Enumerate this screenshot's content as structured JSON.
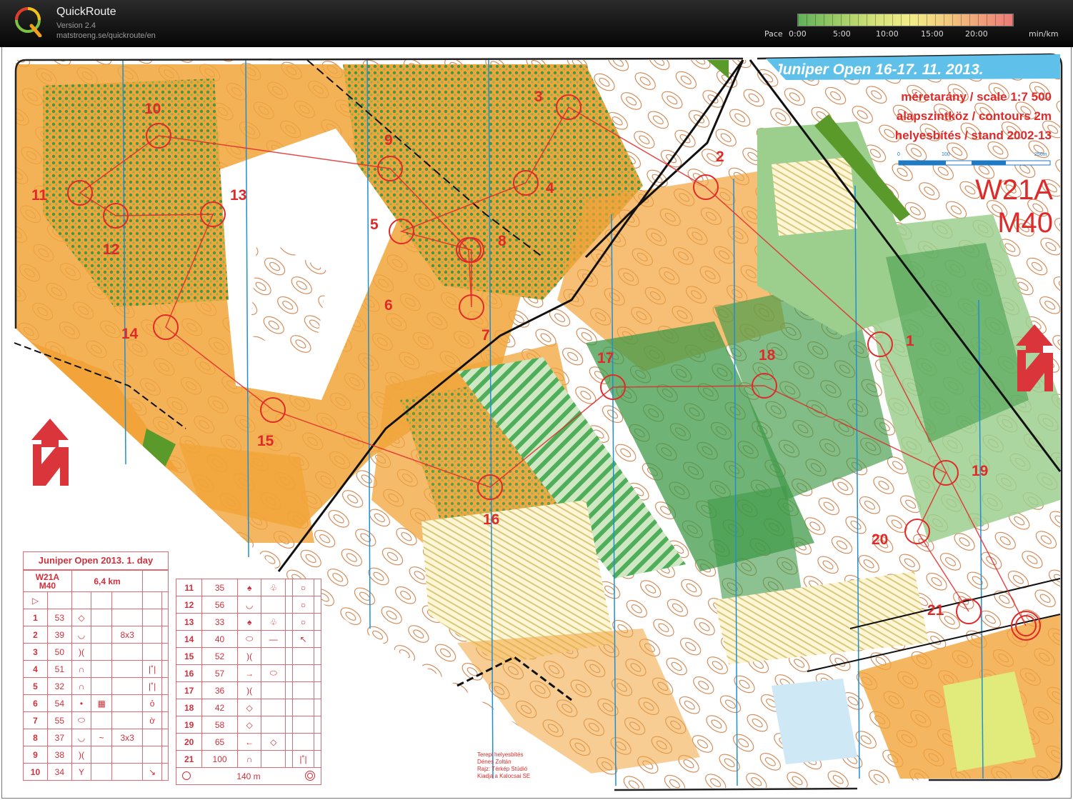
{
  "app": {
    "name": "QuickRoute",
    "version": "Version 2.4",
    "url": "matstroeng.se/quickroute/en",
    "logo_letter": "Q"
  },
  "pace_legend": {
    "title": "Pace",
    "labels": [
      "0:00",
      "5:00",
      "10:00",
      "15:00",
      "20:00"
    ],
    "unit": "min/km",
    "colors": [
      "#5fb05a",
      "#9ccc65",
      "#d6e27a",
      "#f2ee88",
      "#f3d27f",
      "#f0a87a",
      "#ec7a78"
    ]
  },
  "map": {
    "title": "Juniper Open 16-17. 11. 2013.",
    "scale": "méretarány / scale  1:7 500",
    "contours": "alapszintköz / contours  2m",
    "stand": "helyesbítés / stand  2002-13",
    "scale_bar_labels": [
      "0",
      "100",
      "250m"
    ],
    "course_lines": [
      "W21A",
      "M40"
    ],
    "colors": {
      "course": "#e02a2a",
      "open": "#f2a43a",
      "forest": "#3f9a48",
      "light_green": "#9ccf8e",
      "magnetic": "#1f8fd4",
      "title_band": "#5fc0ea"
    },
    "controls": [
      {
        "num": "1"
      },
      {
        "num": "2"
      },
      {
        "num": "3"
      },
      {
        "num": "4"
      },
      {
        "num": "5"
      },
      {
        "num": "6"
      },
      {
        "num": "7"
      },
      {
        "num": "8"
      },
      {
        "num": "9"
      },
      {
        "num": "10"
      },
      {
        "num": "11"
      },
      {
        "num": "12"
      },
      {
        "num": "13"
      },
      {
        "num": "14"
      },
      {
        "num": "15"
      },
      {
        "num": "16"
      },
      {
        "num": "17"
      },
      {
        "num": "18"
      },
      {
        "num": "19"
      },
      {
        "num": "20"
      },
      {
        "num": "21"
      }
    ],
    "credits": [
      "Terepi helyesbítés",
      "Dénes Zoltán",
      "Rajz: Térkép Stúdió",
      "Kiadja a Kalocsai SE"
    ]
  },
  "descriptions": {
    "title": "Juniper Open 2013. 1. day",
    "course": "W21A",
    "course2": "M40",
    "length": "6,4 km",
    "start_symbol": "▷",
    "left_rows": [
      {
        "n": "1",
        "code": "53",
        "sym1": "◇",
        "sym2": "",
        "sym3": "",
        "sym4": ""
      },
      {
        "n": "2",
        "code": "39",
        "sym1": "◡",
        "sym2": "",
        "sym3": "8x3",
        "sym4": ""
      },
      {
        "n": "3",
        "code": "50",
        "sym1": ")(",
        "sym2": "",
        "sym3": "",
        "sym4": ""
      },
      {
        "n": "4",
        "code": "51",
        "sym1": "∩",
        "sym2": "",
        "sym3": "",
        "sym4": "|˚|"
      },
      {
        "n": "5",
        "code": "32",
        "sym1": "∩",
        "sym2": "",
        "sym3": "",
        "sym4": "|˚|"
      },
      {
        "n": "6",
        "code": "54",
        "sym1": "•",
        "sym2": "▦",
        "sym3": "",
        "sym4": "ỏ"
      },
      {
        "n": "7",
        "code": "55",
        "sym1": "⬭",
        "sym2": "",
        "sym3": "",
        "sym4": "ờ"
      },
      {
        "n": "8",
        "code": "37",
        "sym1": "◡",
        "sym2": "~",
        "sym3": "3x3",
        "sym4": ""
      },
      {
        "n": "9",
        "code": "38",
        "sym1": ")(",
        "sym2": "",
        "sym3": "",
        "sym4": ""
      },
      {
        "n": "10",
        "code": "34",
        "sym1": "Y",
        "sym2": "",
        "sym3": "",
        "sym4": "↘"
      }
    ],
    "right_rows": [
      {
        "n": "11",
        "code": "35",
        "sym1": "♠",
        "sym2": "♧",
        "sym3": "",
        "sym4": "○"
      },
      {
        "n": "12",
        "code": "56",
        "sym1": "◡",
        "sym2": "",
        "sym3": "",
        "sym4": "○"
      },
      {
        "n": "13",
        "code": "33",
        "sym1": "♠",
        "sym2": "♧",
        "sym3": "",
        "sym4": "○"
      },
      {
        "n": "14",
        "code": "40",
        "sym1": "⬭",
        "sym2": "—",
        "sym3": "",
        "sym4": "↖"
      },
      {
        "n": "15",
        "code": "52",
        "sym1": ")(",
        "sym2": "",
        "sym3": "",
        "sym4": ""
      },
      {
        "n": "16",
        "code": "57",
        "sym1": "→",
        "sym2": "⬭",
        "sym3": "",
        "sym4": ""
      },
      {
        "n": "17",
        "code": "36",
        "sym1": ")(",
        "sym2": "",
        "sym3": "",
        "sym4": ""
      },
      {
        "n": "18",
        "code": "42",
        "sym1": "◇",
        "sym2": "",
        "sym3": "",
        "sym4": ""
      },
      {
        "n": "19",
        "code": "58",
        "sym1": "◇",
        "sym2": "",
        "sym3": "",
        "sym4": ""
      },
      {
        "n": "20",
        "code": "65",
        "sym1": "←",
        "sym2": "◇",
        "sym3": "",
        "sym4": ""
      },
      {
        "n": "21",
        "code": "100",
        "sym1": "∩",
        "sym2": "",
        "sym3": "",
        "sym4": "|˚|"
      }
    ],
    "finish_text": "140 m"
  }
}
